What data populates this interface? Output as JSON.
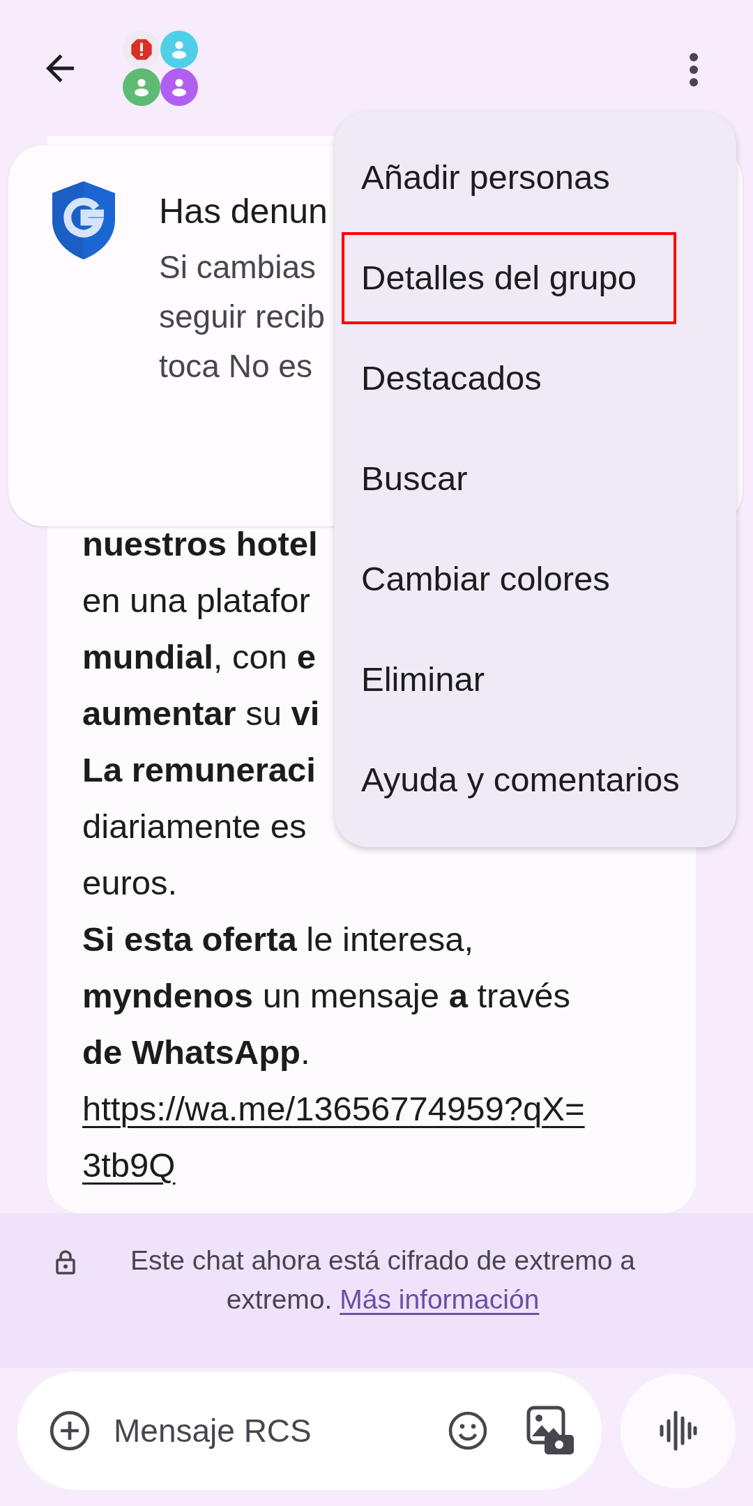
{
  "header": {
    "avatars": [
      {
        "kind": "warning",
        "color": "#d93025"
      },
      {
        "kind": "person",
        "color": "#4fd0e8"
      },
      {
        "kind": "person",
        "color": "#5dbb73"
      },
      {
        "kind": "person",
        "color": "#b05ff2"
      }
    ]
  },
  "safety_card": {
    "title": "Has denun",
    "lines": [
      "Si cambias",
      "seguir recib",
      "toca No es"
    ]
  },
  "message": {
    "lines": [
      {
        "kind": "text",
        "text": "**nuestros hotel**"
      },
      {
        "kind": "text",
        "text": "en una platafor"
      },
      {
        "kind": "text",
        "text": "**mundial**, con **e**"
      },
      {
        "kind": "text",
        "text": "**aumentar** su **vi**"
      },
      {
        "kind": "text",
        "text": "**La remuneraci**"
      },
      {
        "kind": "text",
        "text": "diariamente es"
      },
      {
        "kind": "text",
        "text": "euros."
      },
      {
        "kind": "text",
        "text": "**Si esta oferta** le interesa,"
      },
      {
        "kind": "text",
        "text": "**myndenos** un mensaje **a** través"
      },
      {
        "kind": "text",
        "text": "**de WhatsApp**."
      },
      {
        "kind": "link",
        "text": "https://wa.me/13656774959?qX="
      },
      {
        "kind": "link",
        "text": "3tb9Q"
      }
    ]
  },
  "menu": {
    "items": [
      {
        "label": "Añadir personas",
        "highlighted": false
      },
      {
        "label": "Detalles del grupo",
        "highlighted": true
      },
      {
        "label": "Destacados",
        "highlighted": false
      },
      {
        "label": "Buscar",
        "highlighted": false
      },
      {
        "label": "Cambiar colores",
        "highlighted": false
      },
      {
        "label": "Eliminar",
        "highlighted": false
      },
      {
        "label": "Ayuda y comentarios",
        "highlighted": false
      }
    ]
  },
  "encryption_notice": {
    "text": "Este chat ahora está cifrado de extremo a extremo.",
    "link": "Más información"
  },
  "composer": {
    "placeholder": "Mensaje RCS"
  }
}
